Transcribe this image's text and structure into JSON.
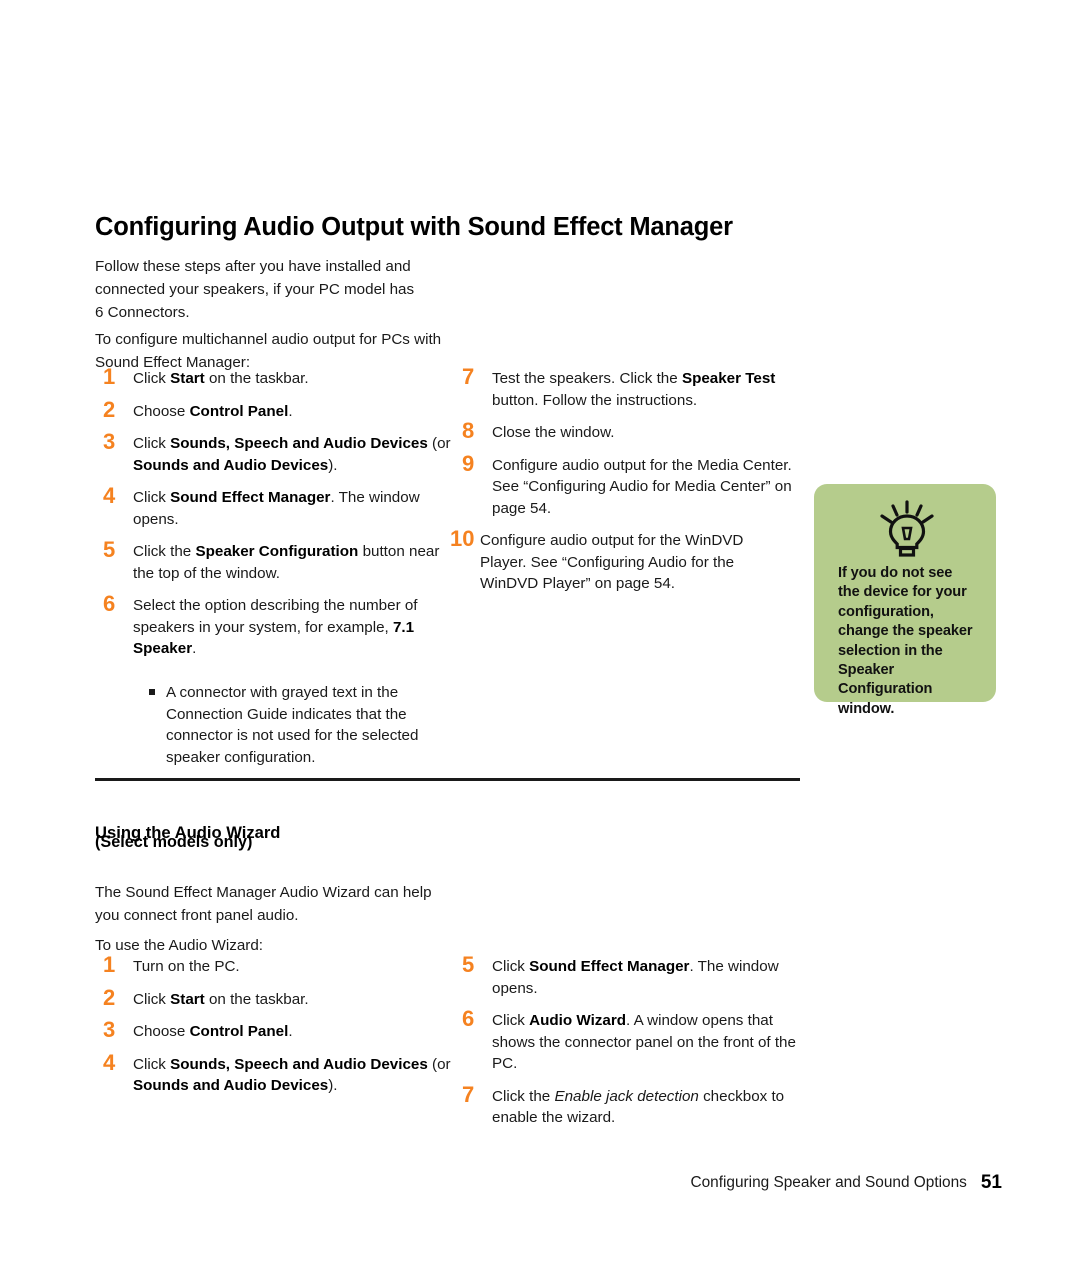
{
  "document": {
    "title": "Configuring Audio Output with Sound Effect Manager",
    "intro_paragraph_1": "Follow these steps after you have installed and connected your speakers, if your PC model has 6 Connectors.",
    "intro_paragraph_2": "To configure multichannel audio output for PCs with Sound Effect Manager:"
  },
  "procedure_1": {
    "left_steps": [
      {
        "number": "1",
        "html": "Click <b>Start</b> on the taskbar."
      },
      {
        "number": "2",
        "html": "Choose <b>Control Panel</b>."
      },
      {
        "number": "3",
        "html": "Click <b>Sounds, Speech and Audio Devices</b> (or <b>Sounds and Audio Devices</b>)."
      },
      {
        "number": "4",
        "html": "Click <b>Sound Effect Manager</b>. The window opens."
      },
      {
        "number": "5",
        "html": "Click the <b>Speaker Configuration</b> button near the top of the window."
      },
      {
        "number": "6",
        "html": "Select the option describing the number of speakers in your system, for example, <b>7.1 Speaker</b>."
      }
    ],
    "sub_bullet": "A connector with grayed text in the Connection Guide indicates that the connector is not used for the selected speaker configuration.",
    "right_steps": [
      {
        "number": "7",
        "html": "Test the speakers. Click the <b>Speaker Test</b> button. Follow the instructions."
      },
      {
        "number": "8",
        "html": "Close the window."
      },
      {
        "number": "9",
        "html": "Configure audio output for the Media Center. See “Configuring Audio for Media Center” on page 54."
      },
      {
        "number": "10",
        "html": "Configure audio output for the WinDVD Player. See “Configuring Audio for the WinDVD Player” on page 54."
      }
    ]
  },
  "tip": {
    "icon": "lightbulb-icon",
    "text": "If you do not see the device for your configuration, change the speaker selection in the Speaker Configuration window.",
    "background_color": "#B5CC8C"
  },
  "section_2": {
    "heading": "Using the Audio Wizard",
    "subheading": "(Select models only)",
    "paragraph_1": "The Sound Effect Manager Audio Wizard can help you connect front panel audio.",
    "paragraph_2": "To use the Audio Wizard:",
    "left_steps": [
      {
        "number": "1",
        "html": "Turn on the PC."
      },
      {
        "number": "2",
        "html": "Click <b>Start</b> on the taskbar."
      },
      {
        "number": "3",
        "html": "Choose <b>Control Panel</b>."
      },
      {
        "number": "4",
        "html": "Click <b>Sounds, Speech and Audio Devices</b> (or <b>Sounds and Audio Devices</b>)."
      }
    ],
    "right_steps": [
      {
        "number": "5",
        "html": "Click <b>Sound Effect Manager</b>. The window opens."
      },
      {
        "number": "6",
        "html": "Click <b>Audio Wizard</b>. A window opens that shows the connector panel on the front of the PC."
      },
      {
        "number": "7",
        "html": "Click the <i>Enable jack detection</i> checkbox to enable the wizard."
      }
    ]
  },
  "footer": {
    "text": "Configuring Speaker and Sound Options",
    "page_number": "51"
  },
  "colors": {
    "step_number": "#F58220",
    "tip_background": "#B5CC8C",
    "text": "#1a1a1a"
  }
}
